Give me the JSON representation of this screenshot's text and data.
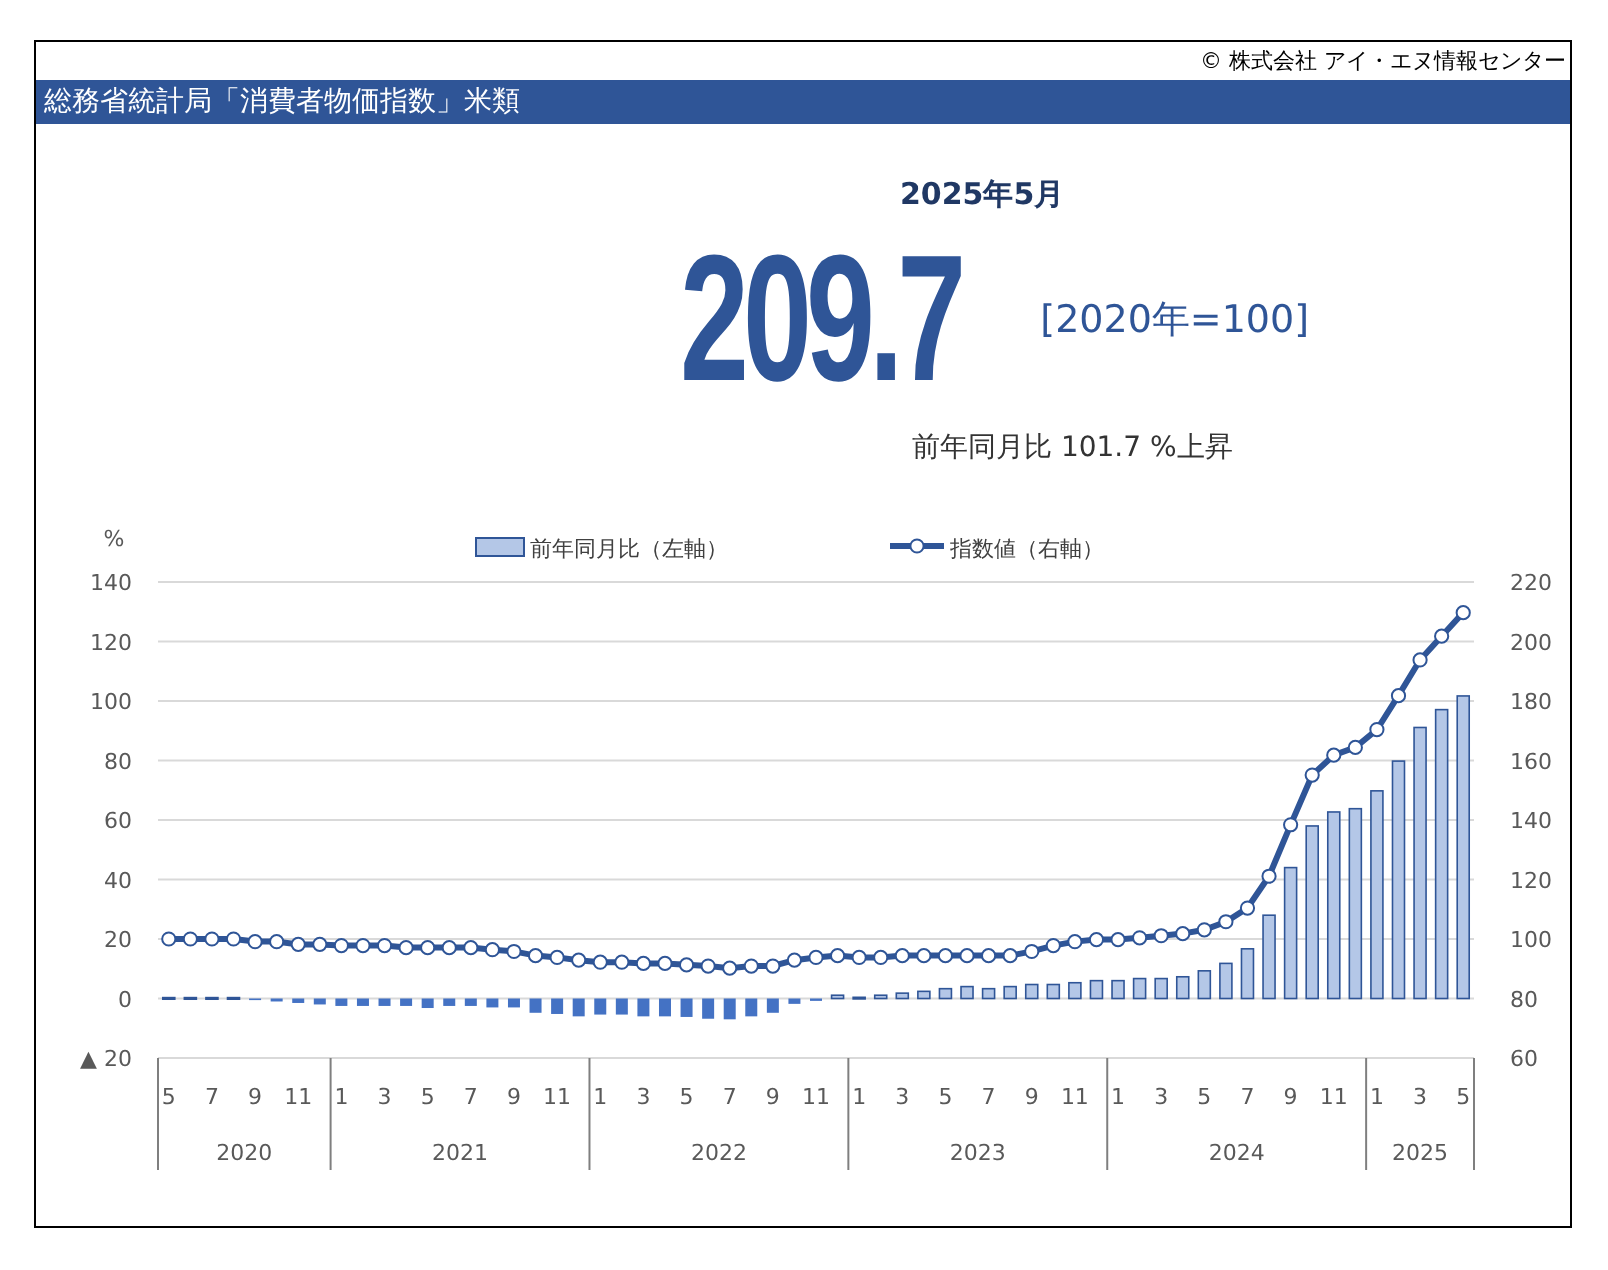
{
  "copyright": "© 株式会社 アイ・エヌ情報センター",
  "title": "総務省統計局「消費者物価指数」米類",
  "period": "2025年5月",
  "value": "209.7",
  "base": "[2020年=100]",
  "change": "前年同月比 101.7 %上昇",
  "yoy_chart": {
    "chart_data": {
      "type": "bar",
      "ylabel": "%",
      "grid": true,
      "stacked": true,
      "categories": [
        "5",
        null,
        "7",
        null,
        "9",
        null,
        "11",
        null,
        "1",
        null,
        "3",
        null,
        "5",
        null,
        "7",
        null,
        "9",
        null,
        "11",
        null,
        "1",
        null,
        "3",
        null,
        "5",
        null,
        "7",
        null,
        "9",
        null,
        "11",
        null,
        "1",
        null,
        "3",
        null,
        "5",
        null,
        "7",
        null,
        "9",
        null,
        "11",
        null,
        "1",
        null,
        "3",
        null,
        "5",
        null,
        "7",
        null,
        "9",
        null,
        "11",
        null,
        "1",
        null,
        "3",
        null,
        "5"
      ],
      "annotations": [
        "2020",
        "2021",
        "2022",
        "2023",
        "2024",
        "2025"
      ],
      "ylim": [
        -20,
        140
      ],
      "yticks": [
        {
          "value": -20,
          "label": "▲ 20"
        },
        0,
        20,
        40,
        60,
        80,
        100,
        120,
        140
      ],
      "series": [
        {
          "name": "前年同月比（左軸）",
          "color": "#b4c7e7",
          "values": [
            0.3,
            0.3,
            0.3,
            0.3,
            null,
            null,
            null,
            null,
            null,
            null,
            null,
            null,
            null,
            null,
            null,
            null,
            null,
            null,
            null,
            null,
            null,
            null,
            null,
            null,
            null,
            null,
            null,
            null,
            null,
            null,
            null,
            1.1,
            0.4,
            1.1,
            1.8,
            2.4,
            3.3,
            4,
            3.3,
            4,
            4.7,
            4.7,
            5.3,
            6,
            6,
            6.7,
            6.7,
            7.3,
            9.3,
            11.8,
            16.7,
            28,
            44,
            58,
            62.7,
            63.8,
            69.8,
            79.8,
            91.1,
            97.1,
            101.7
          ]
        },
        {
          "color": "#4472c4",
          "values": [
            null,
            null,
            null,
            null,
            -0.5,
            -1,
            -1.5,
            -2,
            -2.5,
            -2.5,
            -2.5,
            -2.5,
            -3.2,
            -2.5,
            -2.5,
            -3,
            -3,
            -4.8,
            -5.2,
            -6,
            -5.4,
            -5.4,
            -6,
            -6,
            -6.2,
            -6.8,
            -7,
            -6,
            -4.8,
            -1.8,
            -0.8,
            null,
            null,
            null,
            null,
            null,
            null,
            null,
            null,
            null,
            null,
            null,
            null,
            null,
            null,
            null,
            null,
            null,
            null,
            null,
            null,
            null,
            null,
            null,
            null,
            null,
            null,
            null,
            null,
            null,
            null
          ]
        }
      ]
    }
  },
  "index_chart": {
    "chart_data": {
      "type": "line",
      "categories": [
        null,
        null,
        null,
        null,
        null,
        null,
        null,
        null,
        null,
        null,
        null,
        null,
        null,
        null,
        null,
        null,
        null,
        null,
        null,
        null,
        null,
        null,
        null,
        null,
        null,
        null,
        null,
        null,
        null,
        null,
        null,
        null,
        null,
        null,
        null,
        null,
        null,
        null,
        null,
        null,
        null,
        null,
        null,
        null,
        null,
        null,
        null,
        null,
        null,
        null,
        null,
        null,
        null,
        null,
        null,
        null,
        null,
        null,
        null,
        null,
        null
      ],
      "ylim": [
        60,
        220
      ],
      "yticks": [
        60,
        80,
        100,
        120,
        140,
        160,
        180,
        200,
        220
      ],
      "series": [
        {
          "name": "指数値（右軸）",
          "color": "#2f5597",
          "marker": "o",
          "values": [
            100,
            100,
            100,
            100,
            99.1,
            99.1,
            98.2,
            98.2,
            97.8,
            97.8,
            97.8,
            97.1,
            97.1,
            97.1,
            97.1,
            96.4,
            95.8,
            94.4,
            93.8,
            92.9,
            92.2,
            92.2,
            91.8,
            91.8,
            91.3,
            90.9,
            90.2,
            90.9,
            90.9,
            92.9,
            93.8,
            94.4,
            93.8,
            93.8,
            94.4,
            94.4,
            94.4,
            94.4,
            94.4,
            94.4,
            95.8,
            97.8,
            99.1,
            99.8,
            99.8,
            100.4,
            101.1,
            101.8,
            103.1,
            105.8,
            110.4,
            121.1,
            138.4,
            155.1,
            161.8,
            164.4,
            170.4,
            181.8,
            193.8,
            201.8,
            209.7
          ]
        }
      ]
    }
  }
}
